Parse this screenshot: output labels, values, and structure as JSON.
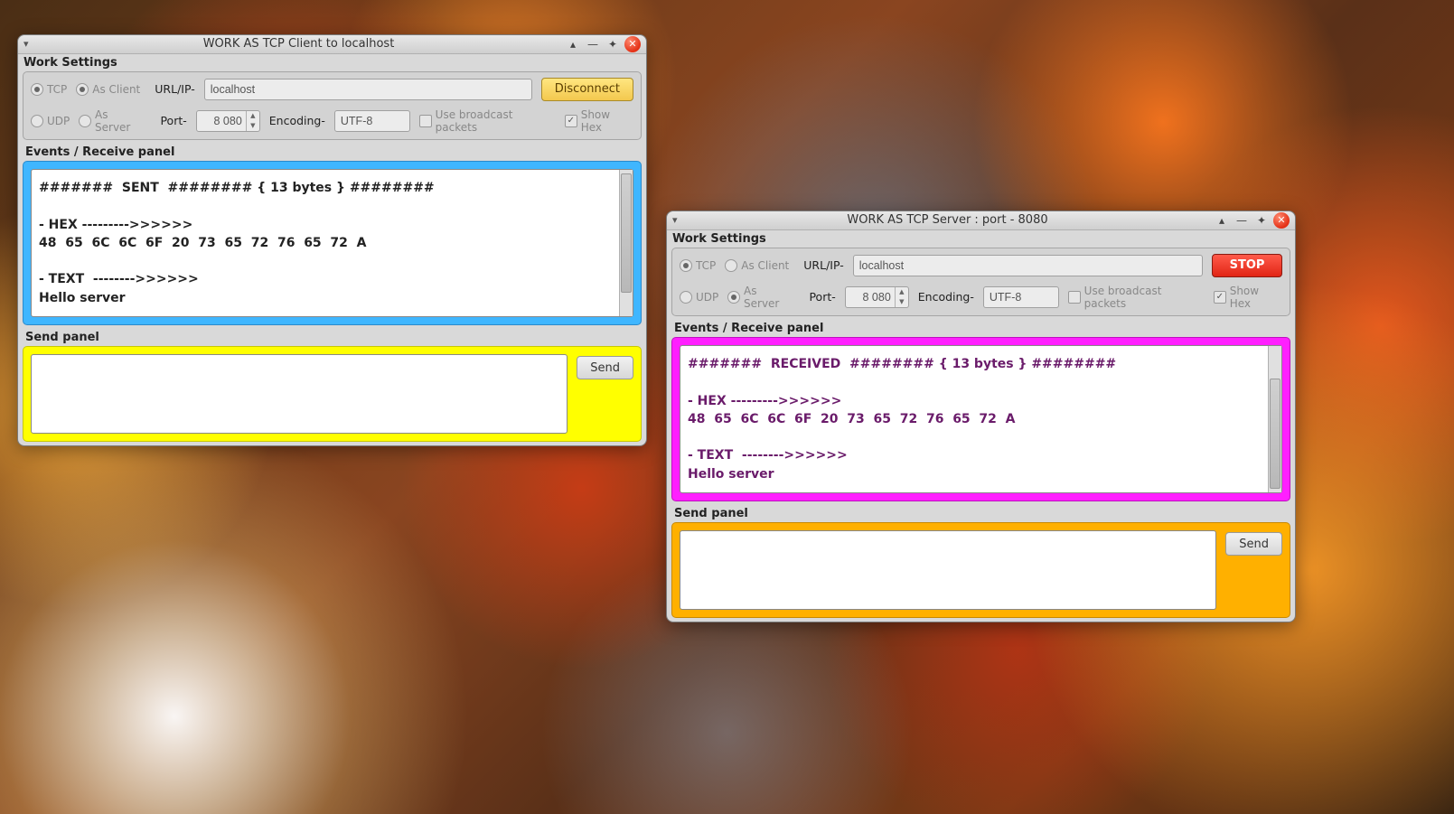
{
  "client_window": {
    "title": "WORK AS  TCP  Client to  localhost",
    "work_settings_label": "Work Settings",
    "row1": {
      "tcp": "TCP",
      "as_client": "As Client",
      "url_label": "URL/IP-",
      "url_value": "localhost",
      "action_button": "Disconnect"
    },
    "row2": {
      "udp": "UDP",
      "as_server": "As Server",
      "port_label": "Port-",
      "port_value": "8 080",
      "encoding_label": "Encoding-",
      "encoding_value": "UTF-8",
      "broadcast": "Use broadcast packets",
      "show_hex": "Show Hex"
    },
    "recv_title": "Events / Receive panel",
    "recv_log": "#######  SENT  ######## { 13 bytes } ########\n\n- HEX --------->>>>>>\n48  65  6C  6C  6F  20  73  65  72  76  65  72  A\n\n- TEXT  -------->>>>>>\nHello server",
    "send_title": "Send panel",
    "send_value": "",
    "send_button": "Send"
  },
  "server_window": {
    "title": "WORK AS  TCP  Server  : port - 8080",
    "work_settings_label": "Work Settings",
    "row1": {
      "tcp": "TCP",
      "as_client": "As Client",
      "url_label": "URL/IP-",
      "url_value": "localhost",
      "action_button": "STOP"
    },
    "row2": {
      "udp": "UDP",
      "as_server": "As Server",
      "port_label": "Port-",
      "port_value": "8 080",
      "encoding_label": "Encoding-",
      "encoding_value": "UTF-8",
      "broadcast": "Use broadcast packets",
      "show_hex": "Show Hex"
    },
    "recv_title": "Events / Receive panel",
    "recv_log": "#######  RECEIVED  ######## { 13 bytes } ########\n\n- HEX --------->>>>>>\n48  65  6C  6C  6F  20  73  65  72  76  65  72  A\n\n- TEXT  -------->>>>>>\nHello server",
    "send_title": "Send panel",
    "send_value": "",
    "send_button": "Send"
  }
}
